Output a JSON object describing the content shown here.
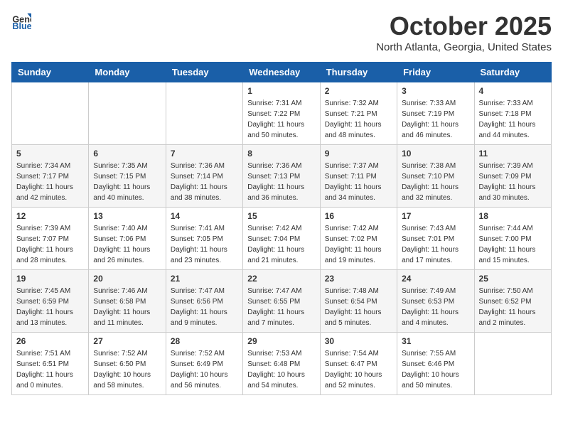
{
  "header": {
    "logo": {
      "text_general": "General",
      "text_blue": "Blue"
    },
    "title": "October 2025",
    "subtitle": "North Atlanta, Georgia, United States"
  },
  "days_of_week": [
    "Sunday",
    "Monday",
    "Tuesday",
    "Wednesday",
    "Thursday",
    "Friday",
    "Saturday"
  ],
  "weeks": [
    [
      {
        "day": "",
        "info": ""
      },
      {
        "day": "",
        "info": ""
      },
      {
        "day": "",
        "info": ""
      },
      {
        "day": "1",
        "info": "Sunrise: 7:31 AM\nSunset: 7:22 PM\nDaylight: 11 hours\nand 50 minutes."
      },
      {
        "day": "2",
        "info": "Sunrise: 7:32 AM\nSunset: 7:21 PM\nDaylight: 11 hours\nand 48 minutes."
      },
      {
        "day": "3",
        "info": "Sunrise: 7:33 AM\nSunset: 7:19 PM\nDaylight: 11 hours\nand 46 minutes."
      },
      {
        "day": "4",
        "info": "Sunrise: 7:33 AM\nSunset: 7:18 PM\nDaylight: 11 hours\nand 44 minutes."
      }
    ],
    [
      {
        "day": "5",
        "info": "Sunrise: 7:34 AM\nSunset: 7:17 PM\nDaylight: 11 hours\nand 42 minutes."
      },
      {
        "day": "6",
        "info": "Sunrise: 7:35 AM\nSunset: 7:15 PM\nDaylight: 11 hours\nand 40 minutes."
      },
      {
        "day": "7",
        "info": "Sunrise: 7:36 AM\nSunset: 7:14 PM\nDaylight: 11 hours\nand 38 minutes."
      },
      {
        "day": "8",
        "info": "Sunrise: 7:36 AM\nSunset: 7:13 PM\nDaylight: 11 hours\nand 36 minutes."
      },
      {
        "day": "9",
        "info": "Sunrise: 7:37 AM\nSunset: 7:11 PM\nDaylight: 11 hours\nand 34 minutes."
      },
      {
        "day": "10",
        "info": "Sunrise: 7:38 AM\nSunset: 7:10 PM\nDaylight: 11 hours\nand 32 minutes."
      },
      {
        "day": "11",
        "info": "Sunrise: 7:39 AM\nSunset: 7:09 PM\nDaylight: 11 hours\nand 30 minutes."
      }
    ],
    [
      {
        "day": "12",
        "info": "Sunrise: 7:39 AM\nSunset: 7:07 PM\nDaylight: 11 hours\nand 28 minutes."
      },
      {
        "day": "13",
        "info": "Sunrise: 7:40 AM\nSunset: 7:06 PM\nDaylight: 11 hours\nand 26 minutes."
      },
      {
        "day": "14",
        "info": "Sunrise: 7:41 AM\nSunset: 7:05 PM\nDaylight: 11 hours\nand 23 minutes."
      },
      {
        "day": "15",
        "info": "Sunrise: 7:42 AM\nSunset: 7:04 PM\nDaylight: 11 hours\nand 21 minutes."
      },
      {
        "day": "16",
        "info": "Sunrise: 7:42 AM\nSunset: 7:02 PM\nDaylight: 11 hours\nand 19 minutes."
      },
      {
        "day": "17",
        "info": "Sunrise: 7:43 AM\nSunset: 7:01 PM\nDaylight: 11 hours\nand 17 minutes."
      },
      {
        "day": "18",
        "info": "Sunrise: 7:44 AM\nSunset: 7:00 PM\nDaylight: 11 hours\nand 15 minutes."
      }
    ],
    [
      {
        "day": "19",
        "info": "Sunrise: 7:45 AM\nSunset: 6:59 PM\nDaylight: 11 hours\nand 13 minutes."
      },
      {
        "day": "20",
        "info": "Sunrise: 7:46 AM\nSunset: 6:58 PM\nDaylight: 11 hours\nand 11 minutes."
      },
      {
        "day": "21",
        "info": "Sunrise: 7:47 AM\nSunset: 6:56 PM\nDaylight: 11 hours\nand 9 minutes."
      },
      {
        "day": "22",
        "info": "Sunrise: 7:47 AM\nSunset: 6:55 PM\nDaylight: 11 hours\nand 7 minutes."
      },
      {
        "day": "23",
        "info": "Sunrise: 7:48 AM\nSunset: 6:54 PM\nDaylight: 11 hours\nand 5 minutes."
      },
      {
        "day": "24",
        "info": "Sunrise: 7:49 AM\nSunset: 6:53 PM\nDaylight: 11 hours\nand 4 minutes."
      },
      {
        "day": "25",
        "info": "Sunrise: 7:50 AM\nSunset: 6:52 PM\nDaylight: 11 hours\nand 2 minutes."
      }
    ],
    [
      {
        "day": "26",
        "info": "Sunrise: 7:51 AM\nSunset: 6:51 PM\nDaylight: 11 hours\nand 0 minutes."
      },
      {
        "day": "27",
        "info": "Sunrise: 7:52 AM\nSunset: 6:50 PM\nDaylight: 10 hours\nand 58 minutes."
      },
      {
        "day": "28",
        "info": "Sunrise: 7:52 AM\nSunset: 6:49 PM\nDaylight: 10 hours\nand 56 minutes."
      },
      {
        "day": "29",
        "info": "Sunrise: 7:53 AM\nSunset: 6:48 PM\nDaylight: 10 hours\nand 54 minutes."
      },
      {
        "day": "30",
        "info": "Sunrise: 7:54 AM\nSunset: 6:47 PM\nDaylight: 10 hours\nand 52 minutes."
      },
      {
        "day": "31",
        "info": "Sunrise: 7:55 AM\nSunset: 6:46 PM\nDaylight: 10 hours\nand 50 minutes."
      },
      {
        "day": "",
        "info": ""
      }
    ]
  ]
}
